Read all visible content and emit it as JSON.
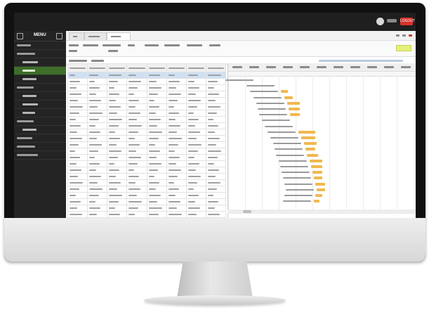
{
  "app": {
    "brand_label": "MENU"
  },
  "header": {
    "logout_label": "LOGOUT"
  },
  "colors": {
    "topbar": "#1f1f1f",
    "sidebar": "#242424",
    "sidebar_active": "#3e6e2a",
    "logout_accent": "#d9322b",
    "gantt_bar": "#f1b84e",
    "selected_row": "#cfe0f3",
    "toolbar_badge": "#e6ef7a"
  },
  "icons": [
    "menu-icon",
    "collapse-icon",
    "user-avatar-icon",
    "search-icon",
    "settings-icon",
    "close-icon"
  ]
}
